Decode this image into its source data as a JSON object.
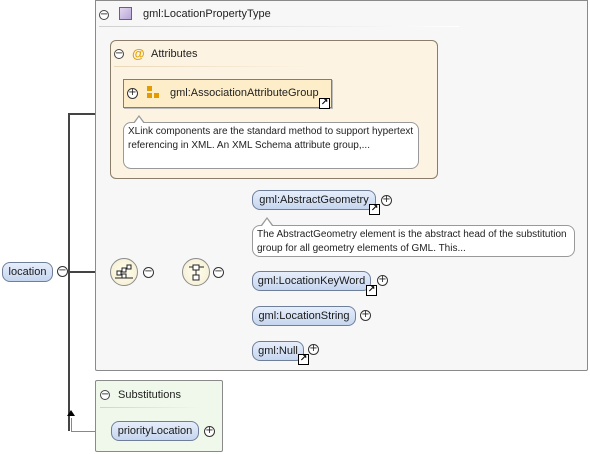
{
  "root": {
    "label": "location"
  },
  "type": {
    "title": "gml:LocationPropertyType"
  },
  "attributes": {
    "title": "Attributes",
    "at_symbol": "@",
    "group_label": "gml:AssociationAttributeGroup",
    "note": "XLink components are the standard method to support hypertext referencing in XML. An XML Schema attribute group,..."
  },
  "choice": {
    "elements": [
      {
        "label": "gml:AbstractGeometry",
        "is_ref": true,
        "expandable": true
      },
      {
        "label": "gml:LocationKeyWord",
        "is_ref": true,
        "expandable": true
      },
      {
        "label": "gml:LocationString",
        "is_ref": false,
        "expandable": true
      },
      {
        "label": "gml:Null",
        "is_ref": true,
        "expandable": true
      }
    ],
    "abstract_note": "The AbstractGeometry element is the abstract head of the substitution group for all geometry elements of GML. This..."
  },
  "substitutions": {
    "title": "Substitutions",
    "items": [
      {
        "label": "priorityLocation",
        "expandable": true
      }
    ]
  },
  "colors": {
    "element_fill": "#c6d6ef",
    "attribute_fill": "#fdf3e2",
    "substitution_fill": "#eff8ea",
    "group_fill": "#fdeec9"
  }
}
